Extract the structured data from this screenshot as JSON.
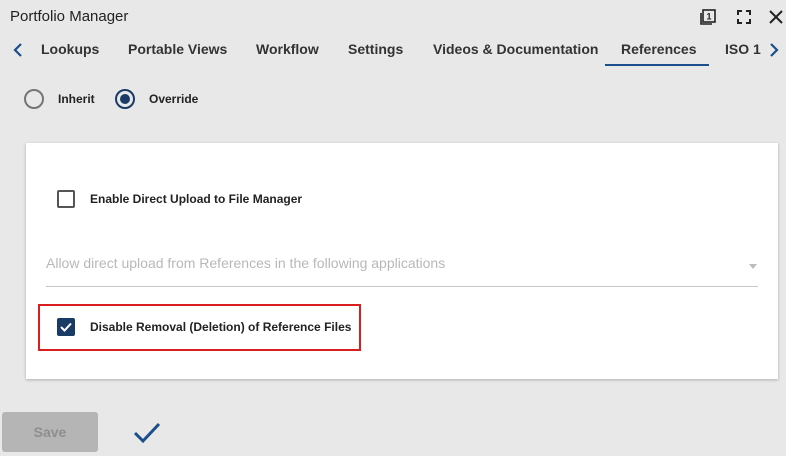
{
  "window": {
    "title": "Portfolio Manager",
    "controls": [
      "badge-1-icon",
      "fullscreen-icon",
      "close-icon"
    ]
  },
  "tabs": {
    "items": [
      {
        "label": "Lookups"
      },
      {
        "label": "Portable Views"
      },
      {
        "label": "Workflow"
      },
      {
        "label": "Settings"
      },
      {
        "label": "Videos & Documentation"
      },
      {
        "label": "References"
      },
      {
        "label": "ISO 1"
      }
    ],
    "active": "References",
    "badge_value": "1"
  },
  "mode": {
    "inherit_label": "Inherit",
    "override_label": "Override",
    "selected": "Override"
  },
  "card": {
    "direct_upload": {
      "label": "Enable Direct Upload to File Manager",
      "checked": false
    },
    "apps_select": {
      "placeholder": "Allow direct upload from References in the following applications"
    },
    "disable_removal": {
      "label": "Disable Removal (Deletion) of Reference Files",
      "checked": true
    }
  },
  "actions": {
    "save_label": "Save",
    "save_enabled": false
  },
  "colors": {
    "accent": "#1a3b66",
    "tab_underline": "#1a4f8b",
    "highlight": "#d91e1e",
    "background": "#e8e8e8"
  }
}
